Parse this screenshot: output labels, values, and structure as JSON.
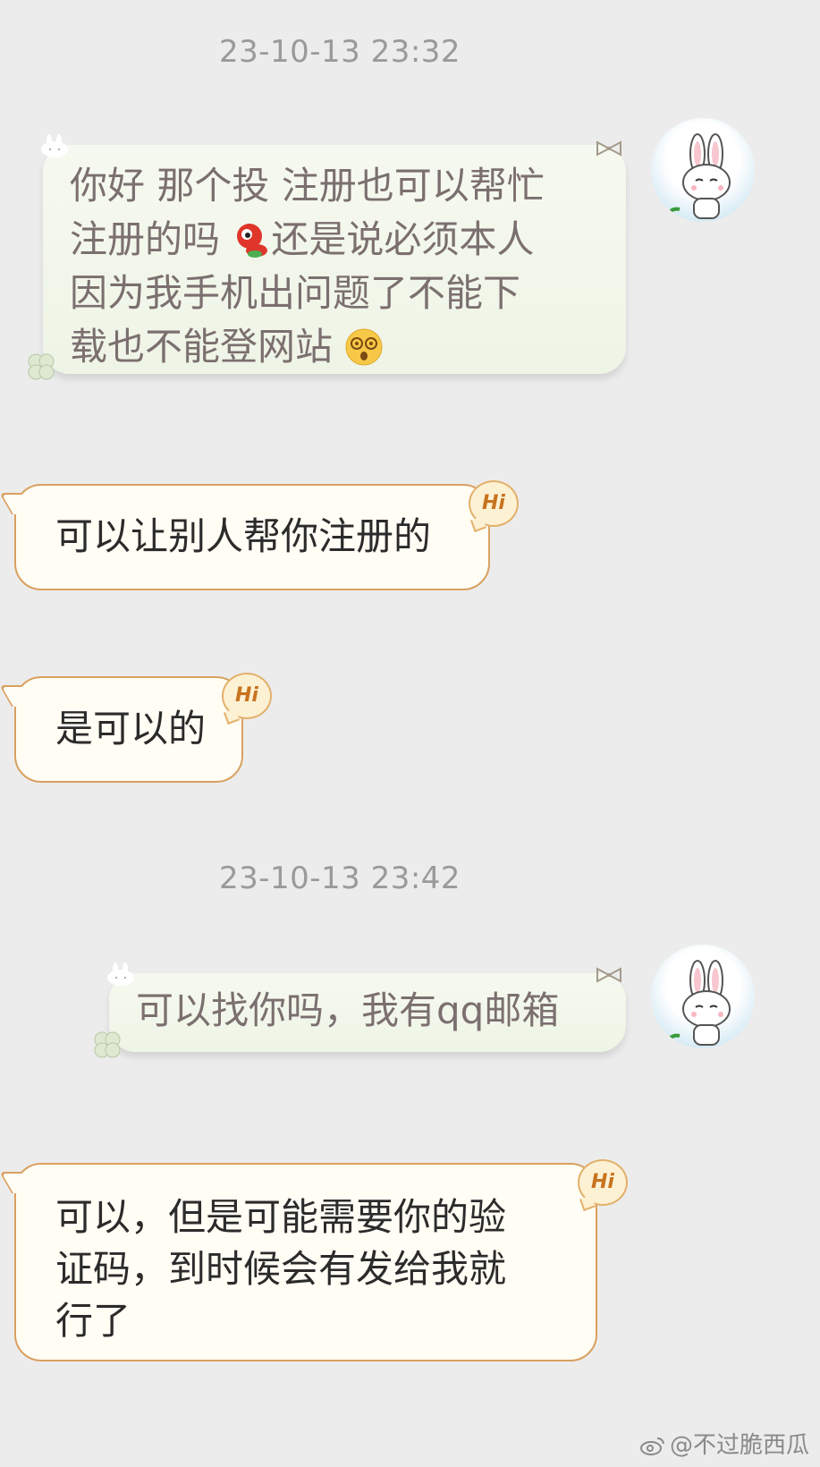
{
  "timestamps": [
    "23-10-13 23:32",
    "23-10-13 23:42"
  ],
  "messages": [
    {
      "side": "right",
      "lines": [
        "你好 那个投 注册也可以帮忙",
        "注册的吗",
        "还是说必须本人",
        "因为我手机出问题了不能下",
        "载也不能登网站"
      ],
      "emoji_after_line2": "red-mascot-emoji",
      "emoji_after_line5": "dizzy-face-emoji"
    },
    {
      "side": "left",
      "text": "可以让别人帮你注册的"
    },
    {
      "side": "left",
      "text": "是可以的"
    },
    {
      "side": "right",
      "text": "可以找你吗，我有qq邮箱"
    },
    {
      "side": "left",
      "lines": [
        "可以，但是可能需要你的验",
        "证码，到时候会有发给我就",
        "行了"
      ]
    }
  ],
  "badge_label": "Hi",
  "watermark": "@不过脆西瓜",
  "colors": {
    "background": "#ececec",
    "outgoing_bubble": "#f2f7ea",
    "incoming_bubble": "#fffdf4",
    "incoming_border": "#d9a060",
    "timestamp": "#9a9a9a"
  }
}
